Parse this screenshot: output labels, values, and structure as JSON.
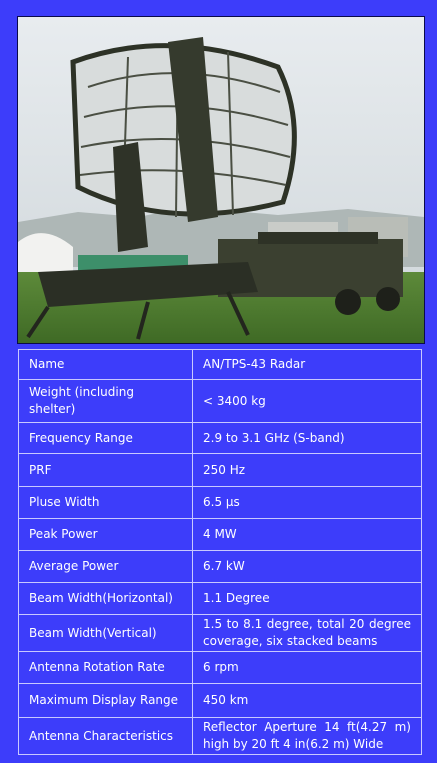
{
  "photo": {
    "subject": "radar-antenna-photo"
  },
  "specs": [
    {
      "label": "Name",
      "value": "AN/TPS-43 Radar"
    },
    {
      "label": "Weight (including shelter)",
      "value": "< 3400 kg"
    },
    {
      "label": "Frequency Range",
      "value": "2.9 to 3.1 GHz (S-band)"
    },
    {
      "label": "PRF",
      "value": "250 Hz"
    },
    {
      "label": "Pluse Width",
      "value": "6.5 µs"
    },
    {
      "label": "Peak Power",
      "value": "4 MW"
    },
    {
      "label": "Average Power",
      "value": "6.7 kW"
    },
    {
      "label": "Beam Width(Horizontal)",
      "value": "1.1 Degree"
    },
    {
      "label": "Beam Width(Vertical)",
      "value": "1.5 to 8.1 degree, total 20 degree coverage, six stacked beams"
    },
    {
      "label": "Antenna Rotation Rate",
      "value": "6 rpm"
    },
    {
      "label": "Maximum Display Range",
      "value": "450 km"
    },
    {
      "label": "Antenna Characteristics",
      "value": "Reflector Aperture 14 ft(4.27 m) high by 20 ft 4 in(6.2 m) Wide"
    }
  ]
}
